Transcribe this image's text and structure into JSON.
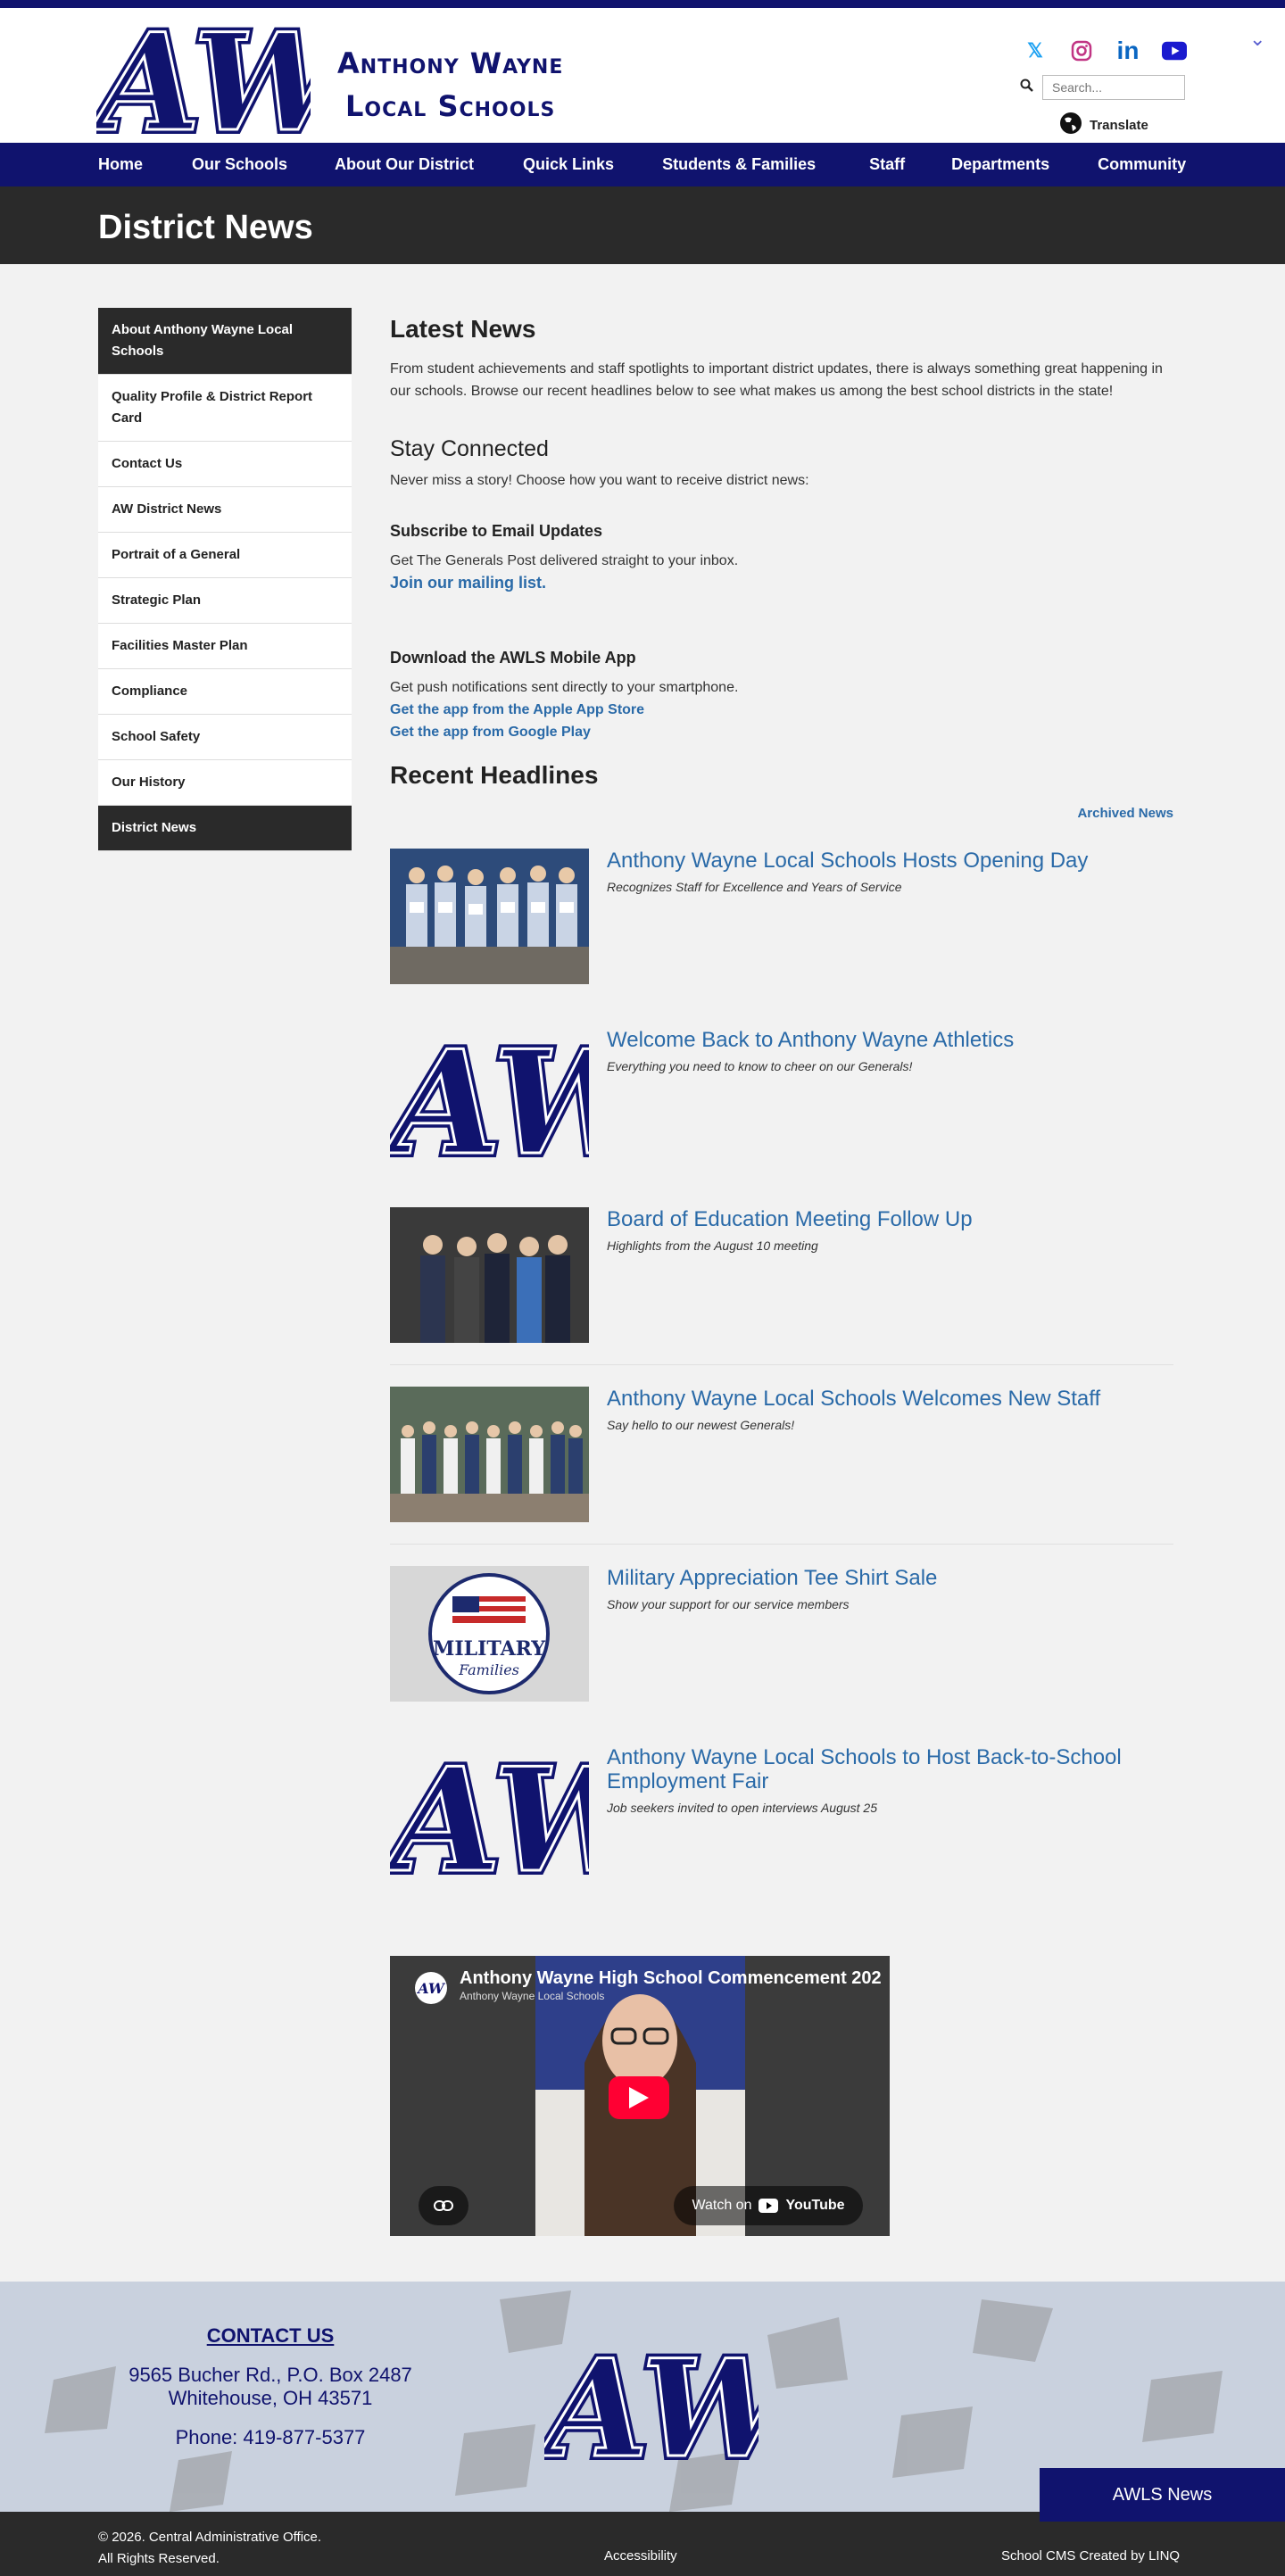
{
  "header": {
    "brand_line1": "Anthony Wayne",
    "brand_line2": "Local Schools",
    "search_placeholder": "Search...",
    "translate_label": "Translate"
  },
  "nav": {
    "items": [
      "Home",
      "Our Schools",
      "About Our District",
      "Quick Links",
      "Students & Families",
      "Staff",
      "Departments",
      "Community"
    ]
  },
  "banner": {
    "title": "District News"
  },
  "sidebar": {
    "items": [
      {
        "label": "About Anthony Wayne Local Schools",
        "active": true
      },
      {
        "label": "Quality Profile & District Report Card"
      },
      {
        "label": "Contact Us"
      },
      {
        "label": "AW District News"
      },
      {
        "label": "Portrait of a General"
      },
      {
        "label": "Strategic Plan"
      },
      {
        "label": "Facilities Master Plan"
      },
      {
        "label": "Compliance"
      },
      {
        "label": "School Safety"
      },
      {
        "label": "Our History"
      },
      {
        "label": "District News",
        "active": true
      }
    ]
  },
  "main": {
    "latest_title": "Latest News",
    "latest_text": "From student achievements and staff spotlights to important district updates, there is always something great happening in our schools. Browse our recent headlines below to see what makes us among the best school districts in the state!",
    "stay_title": "Stay Connected",
    "stay_text": "Never miss a story! Choose how you want to receive district news:",
    "email_title": "Subscribe to Email Updates",
    "email_text": "Get The Generals Post delivered straight to your inbox.",
    "email_link": "Join our mailing list.",
    "app_title": "Download the AWLS Mobile App",
    "app_text": "Get push notifications sent directly to your smartphone.",
    "app_store": "Get the app from the Apple App Store",
    "google_play": "Get the app from Google Play",
    "recent_title": "Recent Headlines",
    "archived": "Archived News"
  },
  "headlines": [
    {
      "title": "Anthony Wayne Local Schools Hosts Opening Day",
      "sub": "Recognizes Staff for Excellence and Years of Service",
      "img": "photo"
    },
    {
      "title": "Welcome Back to Anthony Wayne Athletics",
      "sub": "Everything you need to know to cheer on our Generals!",
      "img": "logo"
    },
    {
      "title": "Board of Education Meeting Follow Up",
      "sub": "Highlights from the August 10 meeting",
      "img": "photo2"
    },
    {
      "title": "Anthony Wayne Local Schools Welcomes New Staff",
      "sub": "Say hello to our newest Generals!",
      "img": "photo3"
    },
    {
      "title": "Military Appreciation Tee Shirt Sale",
      "sub": "Show your support for our service members",
      "img": "shirt"
    },
    {
      "title": "Anthony Wayne Local Schools to Host Back-to-School Employment Fair",
      "sub": "Job seekers invited to open interviews August 25",
      "img": "logo"
    }
  ],
  "video": {
    "title": "Anthony Wayne High School Commencement 202",
    "channel": "Anthony Wayne Local Schools",
    "watch": "Watch on",
    "yt": "YouTube"
  },
  "footer": {
    "contact": "CONTACT US",
    "addr1": "9565 Bucher Rd., P.O. Box 2487",
    "addr2": "Whitehouse, OH 43571",
    "phone": "Phone: 419-877-5377"
  },
  "bottom": {
    "copy": "© 2026. Central Administrative Office.",
    "rights": "All Rights Reserved.",
    "access": "Accessibility",
    "cms": "School CMS Created by LINQ"
  },
  "news_button": "AWLS News",
  "logo_text": "AW"
}
